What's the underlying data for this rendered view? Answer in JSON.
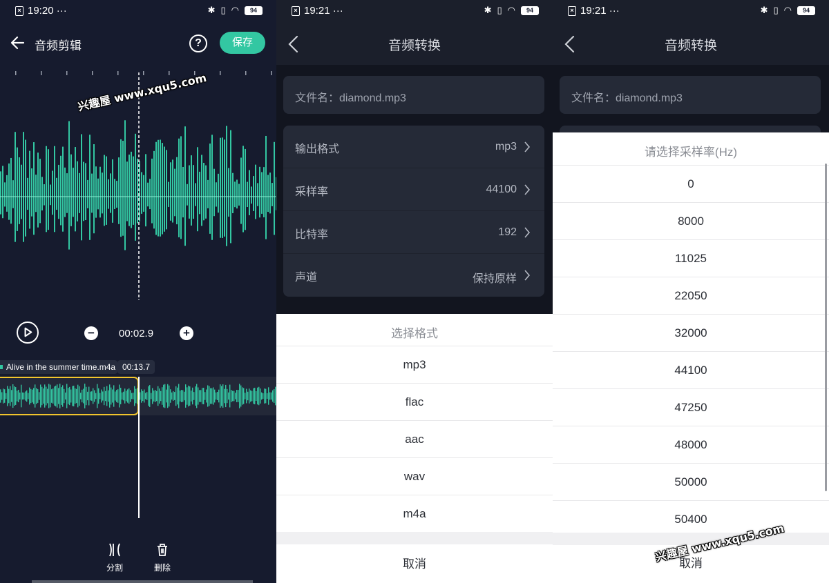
{
  "screen1": {
    "status_time": "19:20 ···",
    "battery": "94",
    "title": "音频剪辑",
    "help_label": "?",
    "save_label": "保存",
    "timecode": "00:02.9",
    "clip_name": "Alive in the summer time.m4a",
    "clip_duration": "00:13.7",
    "split_label": "分割",
    "delete_label": "删除",
    "watermark": "兴趣屋 www.xqu5.com",
    "accent_color": "#33c7a2",
    "selection_color": "#f2c52d"
  },
  "screen2": {
    "status_time": "19:21 ···",
    "battery": "94",
    "title": "音频转换",
    "file_label": "文件名：diamond.mp3",
    "settings": [
      {
        "label": "输出格式",
        "value": "mp3"
      },
      {
        "label": "采样率",
        "value": "44100"
      },
      {
        "label": "比特率",
        "value": "192"
      },
      {
        "label": "声道",
        "value": "保持原样"
      }
    ],
    "sheet_title": "选择格式",
    "options": [
      "mp3",
      "flac",
      "aac",
      "wav",
      "m4a"
    ],
    "cancel_label": "取消"
  },
  "screen3": {
    "status_time": "19:21 ···",
    "battery": "94",
    "title": "音频转换",
    "file_label": "文件名：diamond.mp3",
    "sheet_title": "请选择采样率(Hz)",
    "options": [
      "0",
      "8000",
      "11025",
      "22050",
      "32000",
      "44100",
      "47250",
      "48000",
      "50000",
      "50400"
    ],
    "cancel_label": "取消",
    "watermark": "兴趣屋 www.xqu5.com"
  }
}
